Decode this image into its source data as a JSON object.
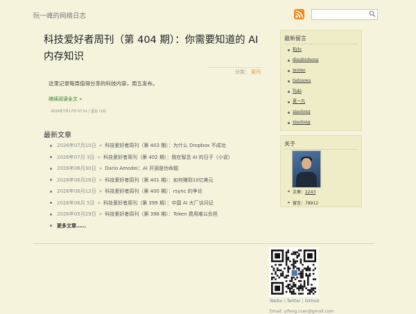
{
  "site": {
    "title": "阮一峰的网络日志"
  },
  "search": {
    "placeholder": ""
  },
  "post": {
    "title": "科技爱好者周刊（第 404 期）：你需要知道的 AI 内存知识",
    "category_label": "分类：",
    "category": "周刊",
    "excerpt": "这里记录每周值得分享的科技内容，周五发布。",
    "read_more": "继续阅读全文 »",
    "date": "2026年7月17日 07:51",
    "comments_link": "留言 (19)"
  },
  "recent": {
    "heading": "最新文章",
    "items": [
      {
        "date": "2026年07月10日",
        "title": "科技爱好者周刊（第 403 期）：为什么 Dropbox 不成功"
      },
      {
        "date": "2026年07月 3日",
        "title": "科技爱好者周刊（第 402 期）：我在智念 AI 的日子（小说）"
      },
      {
        "date": "2026年06月30日",
        "title": "Dario Amodei：AI 开源是伪命题"
      },
      {
        "date": "2026年06月26日",
        "title": "科技爱好者周刊（第 401 期）：如何赚到10亿美元"
      },
      {
        "date": "2026年06月12日",
        "title": "科技爱好者周刊（第 400 期）：rsync 的争论"
      },
      {
        "date": "2026年06月 5日",
        "title": "科技爱好者周刊（第 399 期）：中国 AI 大厂访问记"
      },
      {
        "date": "2026年05月29日",
        "title": "科技爱好者周刊（第 398 期）：Token 费用难以负担"
      }
    ],
    "separator": "»",
    "more": "更多文章……"
  },
  "sidebar": {
    "comments_heading": "最新留言",
    "comments": [
      "Kyle",
      "dingbisheng",
      "momo",
      "tietouwa",
      "Yuki",
      "夏一凡",
      "xiaolong",
      "xiaolong"
    ],
    "about_heading": "关于",
    "articles_label": "文章：",
    "articles_count": "2243",
    "comments_label": "留言：",
    "comments_count": "78912"
  },
  "footer": {
    "links": [
      "Weibo",
      "Twitter",
      "GitHub"
    ],
    "link_separator": "|",
    "email": "Email: yifeng.ruan@gmail.com"
  },
  "icons": {
    "rss": "rss-icon",
    "search": "search-icon",
    "qr": "qr-code",
    "avatar": "author-avatar"
  },
  "colors": {
    "background": "#f5f3dc",
    "sidebar": "#efedc8",
    "accent": "#d89a3a",
    "link_green": "#2a7a2a",
    "rss": "#f28a1f"
  }
}
